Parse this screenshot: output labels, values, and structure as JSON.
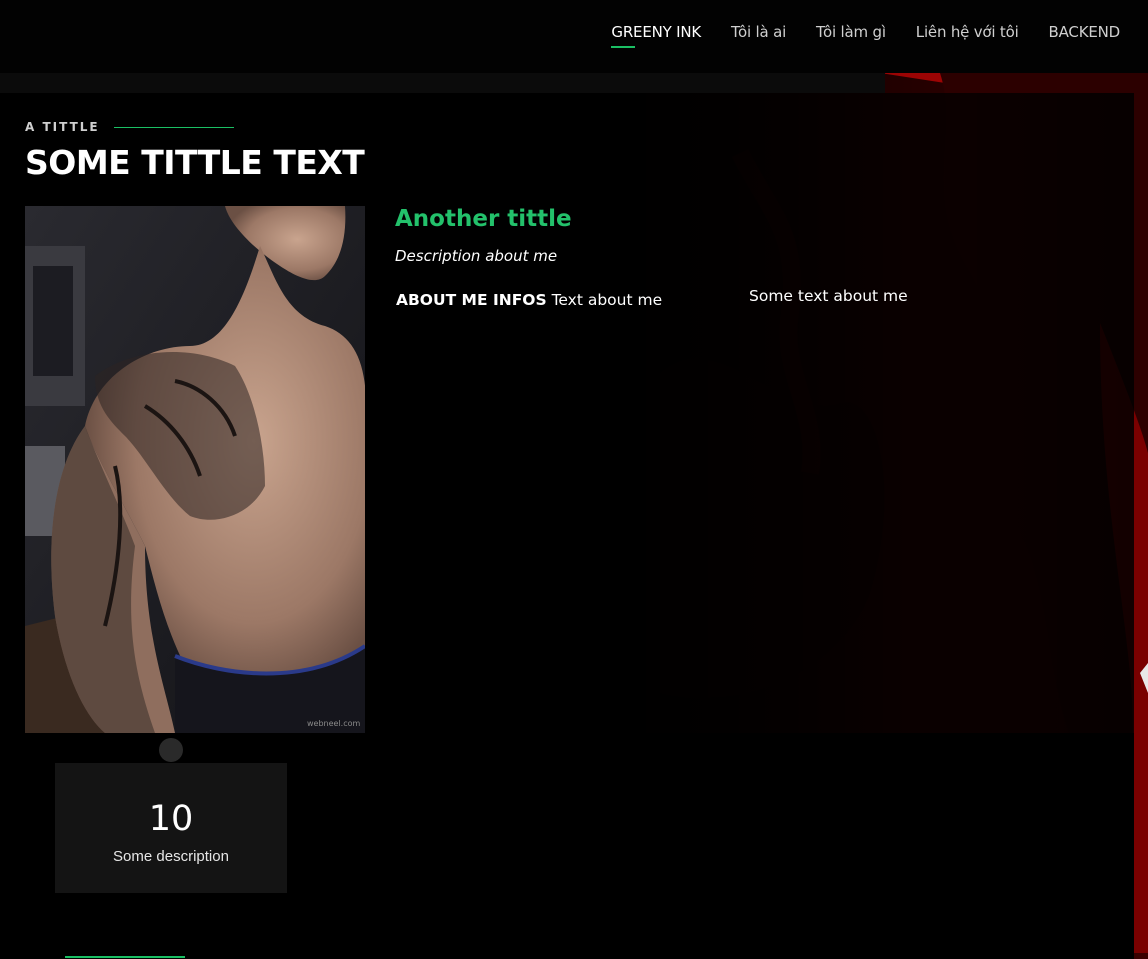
{
  "nav": {
    "items": [
      {
        "label": "GREENY INK",
        "active": true
      },
      {
        "label": "Tôi là ai",
        "active": false
      },
      {
        "label": "Tôi làm gì",
        "active": false
      },
      {
        "label": "Liên hệ với tôi",
        "active": false
      },
      {
        "label": "BACKEND",
        "active": false
      }
    ]
  },
  "section": {
    "kicker": "A TITTLE",
    "title": "SOME TITTLE TEXT"
  },
  "about": {
    "subtitle": "Another tittle",
    "description": "Description about me",
    "info_label": "ABOUT ME INFOS",
    "info_text": "Text about me",
    "side_text": "Some text about me",
    "photo_watermark": "webneel.com"
  },
  "stat": {
    "number": "10",
    "label": "Some description"
  },
  "colors": {
    "accent": "#1bbf64",
    "accent_text": "#23c16b",
    "background": "#000000",
    "card": "#141414",
    "art_red": "#8a0000"
  }
}
